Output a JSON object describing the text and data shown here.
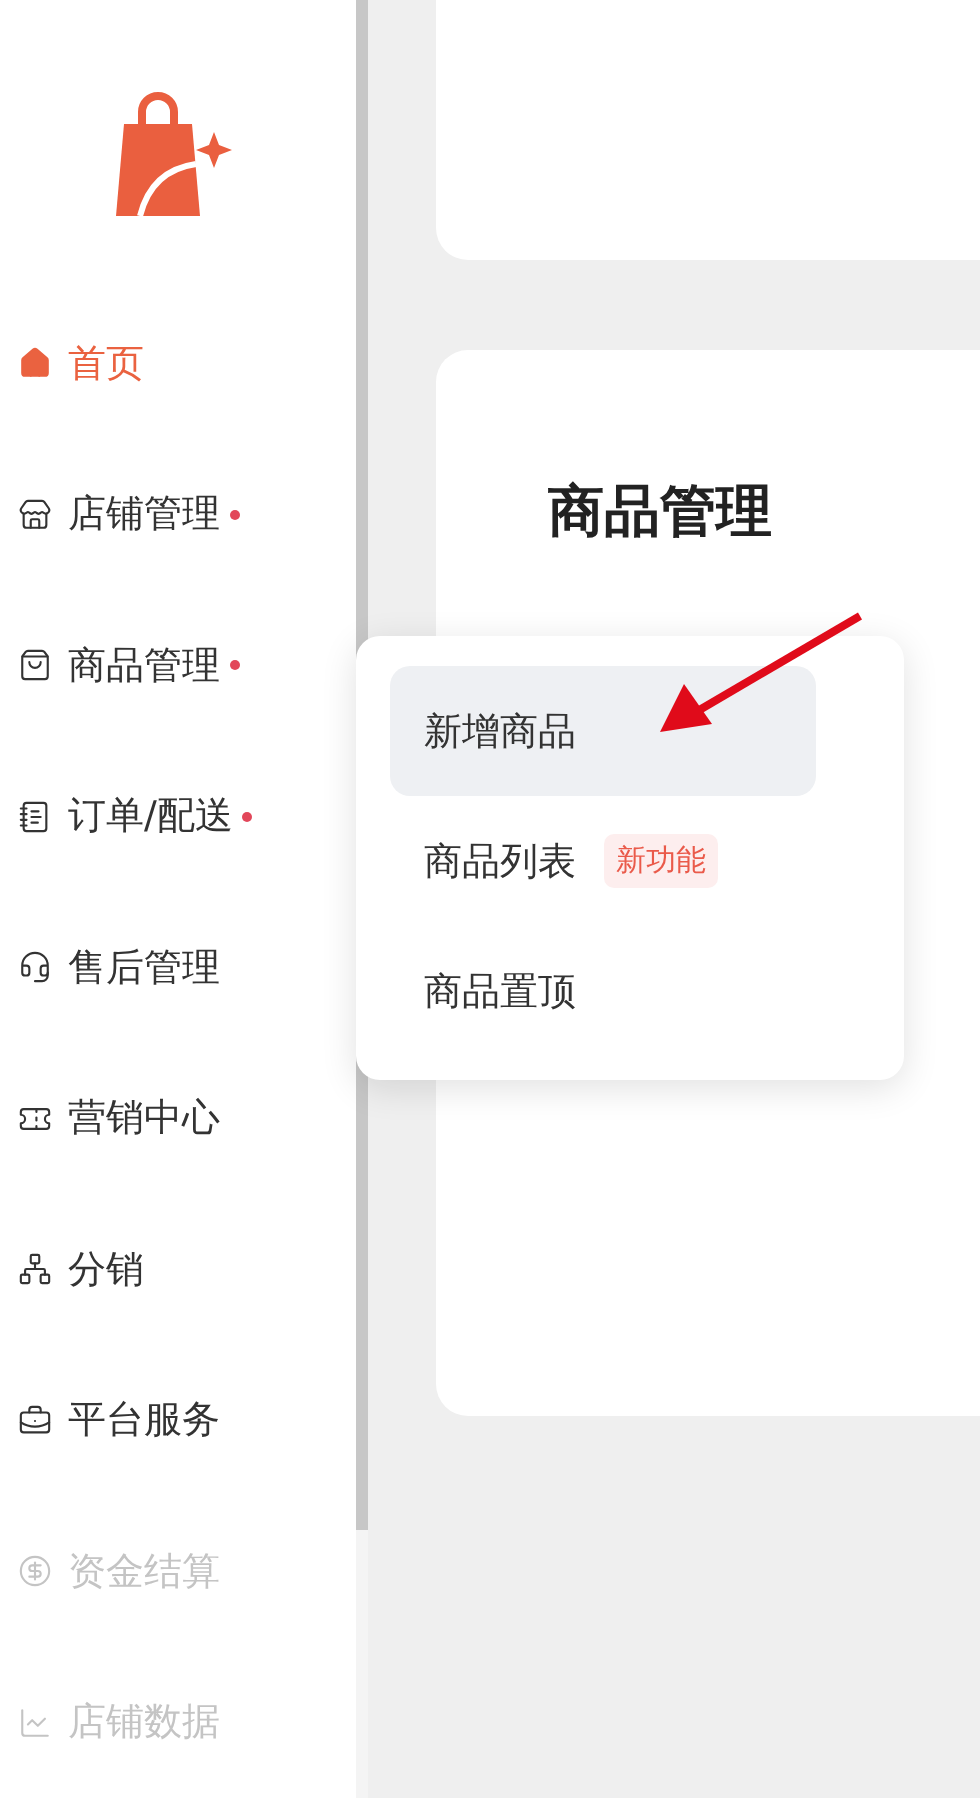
{
  "sidebar": {
    "items": [
      {
        "label": "首页",
        "selected": true,
        "dot": false,
        "disabled": false
      },
      {
        "label": "店铺管理",
        "selected": false,
        "dot": true,
        "disabled": false
      },
      {
        "label": "商品管理",
        "selected": false,
        "dot": true,
        "disabled": false
      },
      {
        "label": "订单/配送",
        "selected": false,
        "dot": true,
        "disabled": false
      },
      {
        "label": "售后管理",
        "selected": false,
        "dot": false,
        "disabled": false
      },
      {
        "label": "营销中心",
        "selected": false,
        "dot": false,
        "disabled": false
      },
      {
        "label": "分销",
        "selected": false,
        "dot": false,
        "disabled": false
      },
      {
        "label": "平台服务",
        "selected": false,
        "dot": false,
        "disabled": false
      },
      {
        "label": "资金结算",
        "selected": false,
        "dot": false,
        "disabled": true
      },
      {
        "label": "店铺数据",
        "selected": false,
        "dot": false,
        "disabled": true
      }
    ]
  },
  "content": {
    "title": "商品管理"
  },
  "submenu": {
    "items": [
      {
        "label": "新增商品",
        "selected": true
      },
      {
        "label": "商品列表",
        "selected": false,
        "badge": "新功能"
      },
      {
        "label": "商品置顶",
        "selected": false
      }
    ]
  }
}
